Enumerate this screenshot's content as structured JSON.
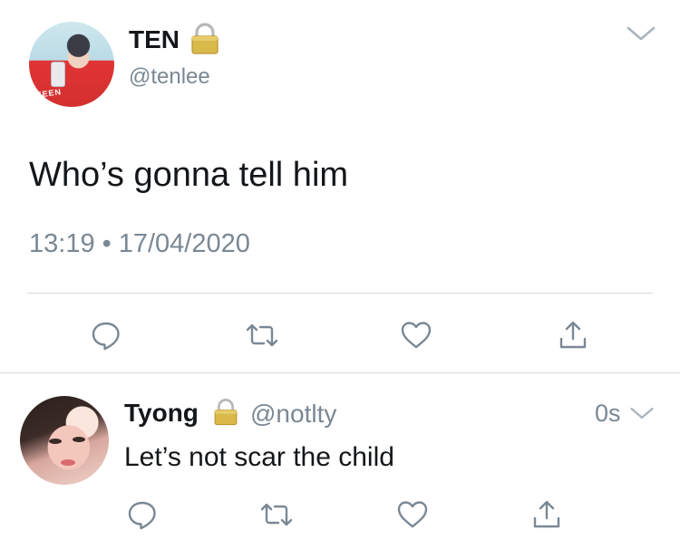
{
  "tweet": {
    "author_name": "TEN",
    "author_handle": "@tenlee",
    "locked": true,
    "text": "Who’s gonna tell him",
    "time": "13:19",
    "separator": "•",
    "date": "17/04/2020",
    "avatar_logo_text": "TEEN",
    "icons": {
      "reply": "reply-icon",
      "retweet": "retweet-icon",
      "like": "heart-icon",
      "share": "share-icon",
      "menu": "chevron-down-icon",
      "lock": "lock-icon"
    }
  },
  "reply": {
    "author_name": "Tyong",
    "author_handle": "@notlty",
    "locked": true,
    "time": "0s",
    "text": "Let’s not scar the child"
  },
  "colors": {
    "text_primary": "#14171a",
    "text_secondary": "#7a8894",
    "divider": "#d4d9de",
    "background": "#ffffff"
  }
}
